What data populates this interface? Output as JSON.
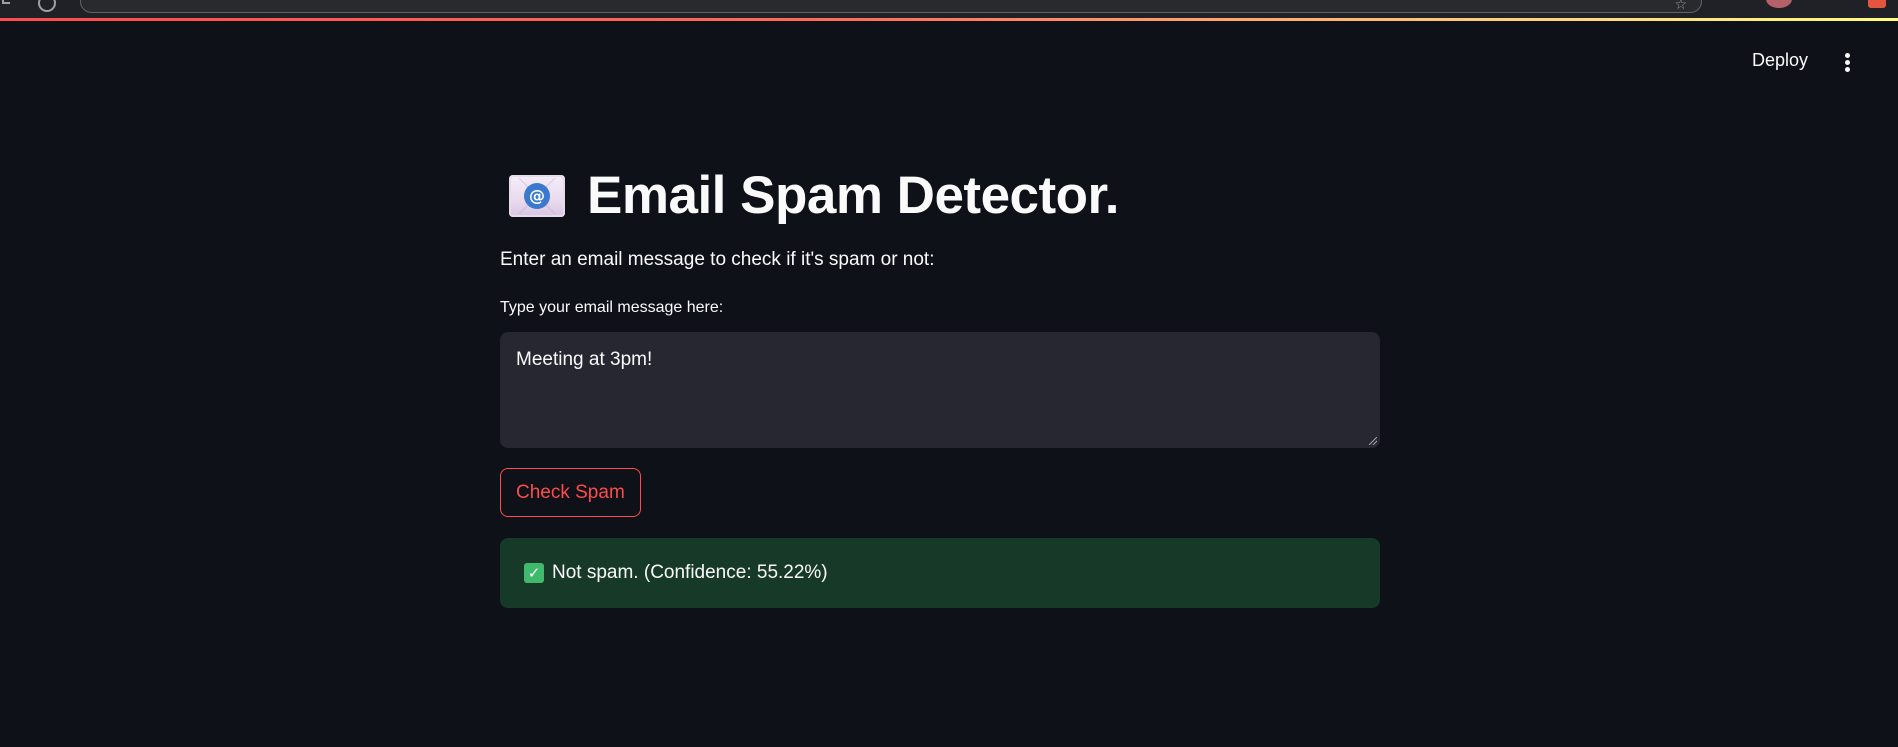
{
  "app": {
    "header": {
      "deploy_label": "Deploy"
    },
    "title": "Email Spam Detector.",
    "subtitle": "Enter an email message to check if it's spam or not:",
    "input": {
      "label": "Type your email message here:",
      "value": "Meeting at 3pm!"
    },
    "check_button_label": "Check Spam",
    "result": {
      "text": "Not spam. (Confidence: 55.22%)",
      "status": "success",
      "icon": "check-mark-emoji"
    },
    "title_icon": "email-envelope-emoji"
  },
  "colors": {
    "background": "#0e1117",
    "input_background": "#262730",
    "accent": "#ff4b4b",
    "success_background": "#173928",
    "success_icon": "#3fb96b"
  }
}
